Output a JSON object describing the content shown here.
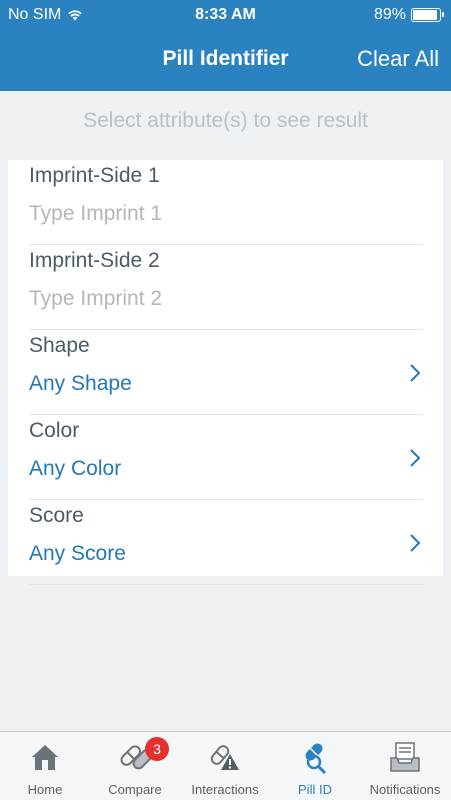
{
  "status_bar": {
    "carrier": "No SIM",
    "time": "8:33 AM",
    "battery": "89%"
  },
  "nav": {
    "title": "Pill Identifier",
    "action": "Clear All"
  },
  "hint": "Select attribute(s) to see result",
  "fields": [
    {
      "label": "Imprint-Side 1",
      "value": "Type Imprint 1"
    },
    {
      "label": "Imprint-Side 2",
      "value": "Type Imprint 2"
    },
    {
      "label": "Shape",
      "value": "Any Shape"
    },
    {
      "label": "Color",
      "value": "Any Color"
    },
    {
      "label": "Score",
      "value": "Any Score"
    }
  ],
  "tabs": [
    {
      "label": "Home",
      "icon": "home-icon"
    },
    {
      "label": "Compare",
      "icon": "pills-icon",
      "badge": "3"
    },
    {
      "label": "Interactions",
      "icon": "interactions-warning-icon"
    },
    {
      "label": "Pill ID",
      "icon": "pill-search-icon",
      "active": true
    },
    {
      "label": "Notifications",
      "icon": "inbox-icon"
    }
  ],
  "colors": {
    "brand": "#2a82c1",
    "value_blue": "#2478b6",
    "badge_red": "#e2312f",
    "background": "#edf1f4"
  }
}
